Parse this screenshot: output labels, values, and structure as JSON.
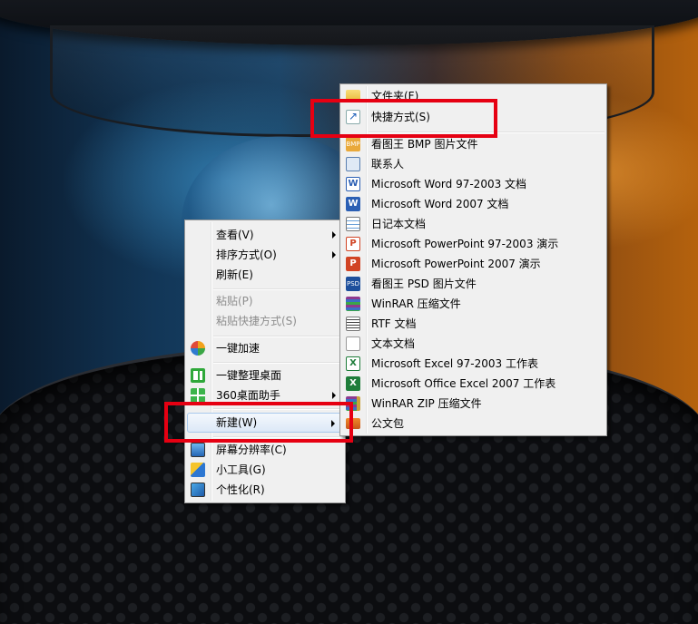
{
  "context_menu": {
    "items": [
      {
        "label": "查看(V)",
        "submenu": true,
        "disabled": false
      },
      {
        "label": "排序方式(O)",
        "submenu": true,
        "disabled": false
      },
      {
        "label": "刷新(E)",
        "submenu": false,
        "disabled": false
      },
      {
        "label": "粘贴(P)",
        "submenu": false,
        "disabled": true
      },
      {
        "label": "粘贴快捷方式(S)",
        "submenu": false,
        "disabled": true
      },
      {
        "label": "一键加速",
        "submenu": false,
        "disabled": false,
        "icon": "speedup-icon"
      },
      {
        "label": "一键整理桌面",
        "submenu": false,
        "disabled": false,
        "icon": "desktop-organize-icon"
      },
      {
        "label": "360桌面助手",
        "submenu": true,
        "disabled": false,
        "icon": "desktop-assistant-icon"
      },
      {
        "label": "新建(W)",
        "submenu": true,
        "disabled": false,
        "highlighted": true
      },
      {
        "label": "屏幕分辨率(C)",
        "submenu": false,
        "disabled": false,
        "icon": "screen-resolution-icon"
      },
      {
        "label": "小工具(G)",
        "submenu": false,
        "disabled": false,
        "icon": "gadgets-icon"
      },
      {
        "label": "个性化(R)",
        "submenu": false,
        "disabled": false,
        "icon": "personalize-icon"
      }
    ]
  },
  "new_submenu": {
    "items": [
      {
        "label": "文件夹(F)",
        "icon": "folder-icon"
      },
      {
        "label": "快捷方式(S)",
        "icon": "shortcut-icon"
      },
      {
        "label": "看图王 BMP 图片文件",
        "icon": "bmp-file-icon"
      },
      {
        "label": "联系人",
        "icon": "contact-icon"
      },
      {
        "label": "Microsoft Word 97-2003 文档",
        "icon": "word-97-icon"
      },
      {
        "label": "Microsoft Word 2007 文档",
        "icon": "word-2007-icon"
      },
      {
        "label": "日记本文档",
        "icon": "journal-icon"
      },
      {
        "label": "Microsoft PowerPoint 97-2003 演示",
        "icon": "ppt-97-icon"
      },
      {
        "label": "Microsoft PowerPoint 2007 演示",
        "icon": "ppt-2007-icon"
      },
      {
        "label": "看图王 PSD 图片文件",
        "icon": "psd-file-icon"
      },
      {
        "label": "WinRAR 压缩文件",
        "icon": "winrar-icon"
      },
      {
        "label": "RTF 文档",
        "icon": "rtf-icon"
      },
      {
        "label": "文本文档",
        "icon": "text-file-icon"
      },
      {
        "label": "Microsoft Excel 97-2003 工作表",
        "icon": "excel-97-icon"
      },
      {
        "label": "Microsoft Office Excel 2007 工作表",
        "icon": "excel-2007-icon"
      },
      {
        "label": "WinRAR ZIP 压缩文件",
        "icon": "winrar-zip-icon"
      },
      {
        "label": "公文包",
        "icon": "briefcase-icon"
      }
    ]
  },
  "icon_text": {
    "bmp": "BMP",
    "psd": "PSD",
    "word": "W",
    "ppt": "P",
    "excel": "X"
  },
  "annotation_color": "#e60012"
}
